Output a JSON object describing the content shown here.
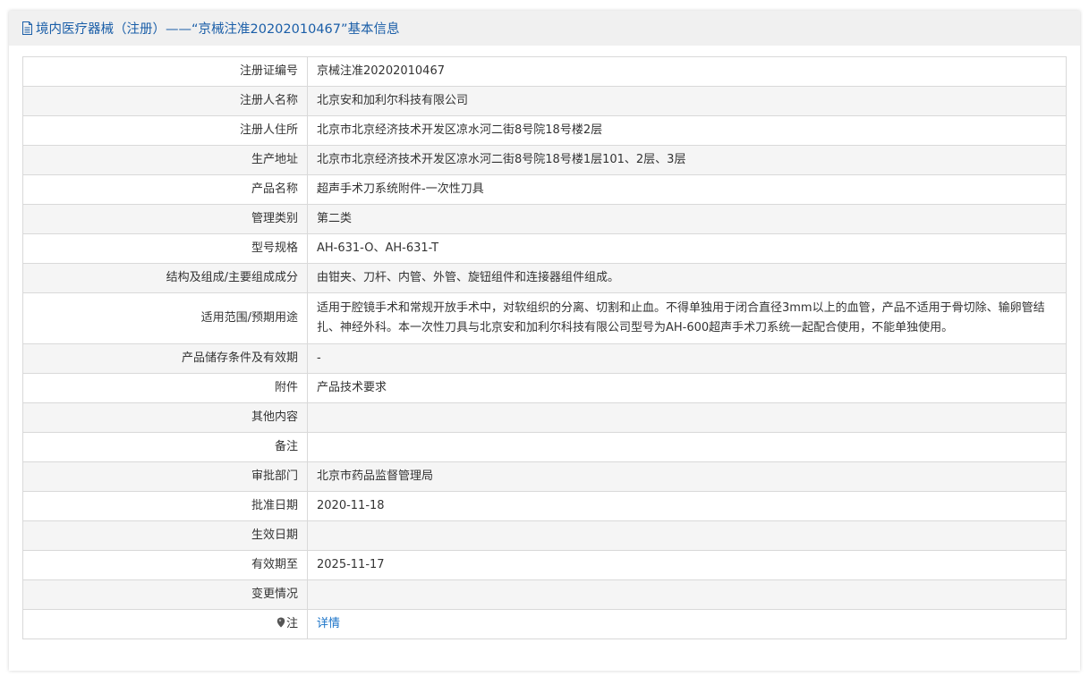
{
  "header": {
    "title": "境内医疗器械（注册）——“京械注准20202010467”基本信息",
    "icon": "document-icon",
    "color": "#1a5ea8"
  },
  "rows": [
    {
      "label": "注册证编号",
      "value": "京械注准20202010467"
    },
    {
      "label": "注册人名称",
      "value": "北京安和加利尔科技有限公司"
    },
    {
      "label": "注册人住所",
      "value": "北京市北京经济技术开发区凉水河二街8号院18号楼2层"
    },
    {
      "label": "生产地址",
      "value": "北京市北京经济技术开发区凉水河二街8号院18号楼1层101、2层、3层"
    },
    {
      "label": "产品名称",
      "value": "超声手术刀系统附件-一次性刀具"
    },
    {
      "label": "管理类别",
      "value": "第二类"
    },
    {
      "label": "型号规格",
      "value": "AH-631-O、AH-631-T"
    },
    {
      "label": "结构及组成/主要组成成分",
      "value": "由钳夹、刀杆、内管、外管、旋钮组件和连接器组件组成。"
    },
    {
      "label": "适用范围/预期用途",
      "value": "适用于腔镜手术和常规开放手术中，对软组织的分离、切割和止血。不得单独用于闭合直径3mm以上的血管，产品不适用于骨切除、输卵管结扎、神经外科。本一次性刀具与北京安和加利尔科技有限公司型号为AH-600超声手术刀系统一起配合使用，不能单独使用。"
    },
    {
      "label": "产品储存条件及有效期",
      "value": "-"
    },
    {
      "label": "附件",
      "value": "产品技术要求"
    },
    {
      "label": "其他内容",
      "value": ""
    },
    {
      "label": "备注",
      "value": ""
    },
    {
      "label": "审批部门",
      "value": "北京市药品监督管理局"
    },
    {
      "label": "批准日期",
      "value": "2020-11-18"
    },
    {
      "label": "生效日期",
      "value": ""
    },
    {
      "label": "有效期至",
      "value": "2025-11-17"
    },
    {
      "label": "变更情况",
      "value": ""
    }
  ],
  "note_row": {
    "label": "注",
    "icon": "location-pin-icon",
    "link_text": "详情",
    "link_color": "#1a73c8"
  }
}
